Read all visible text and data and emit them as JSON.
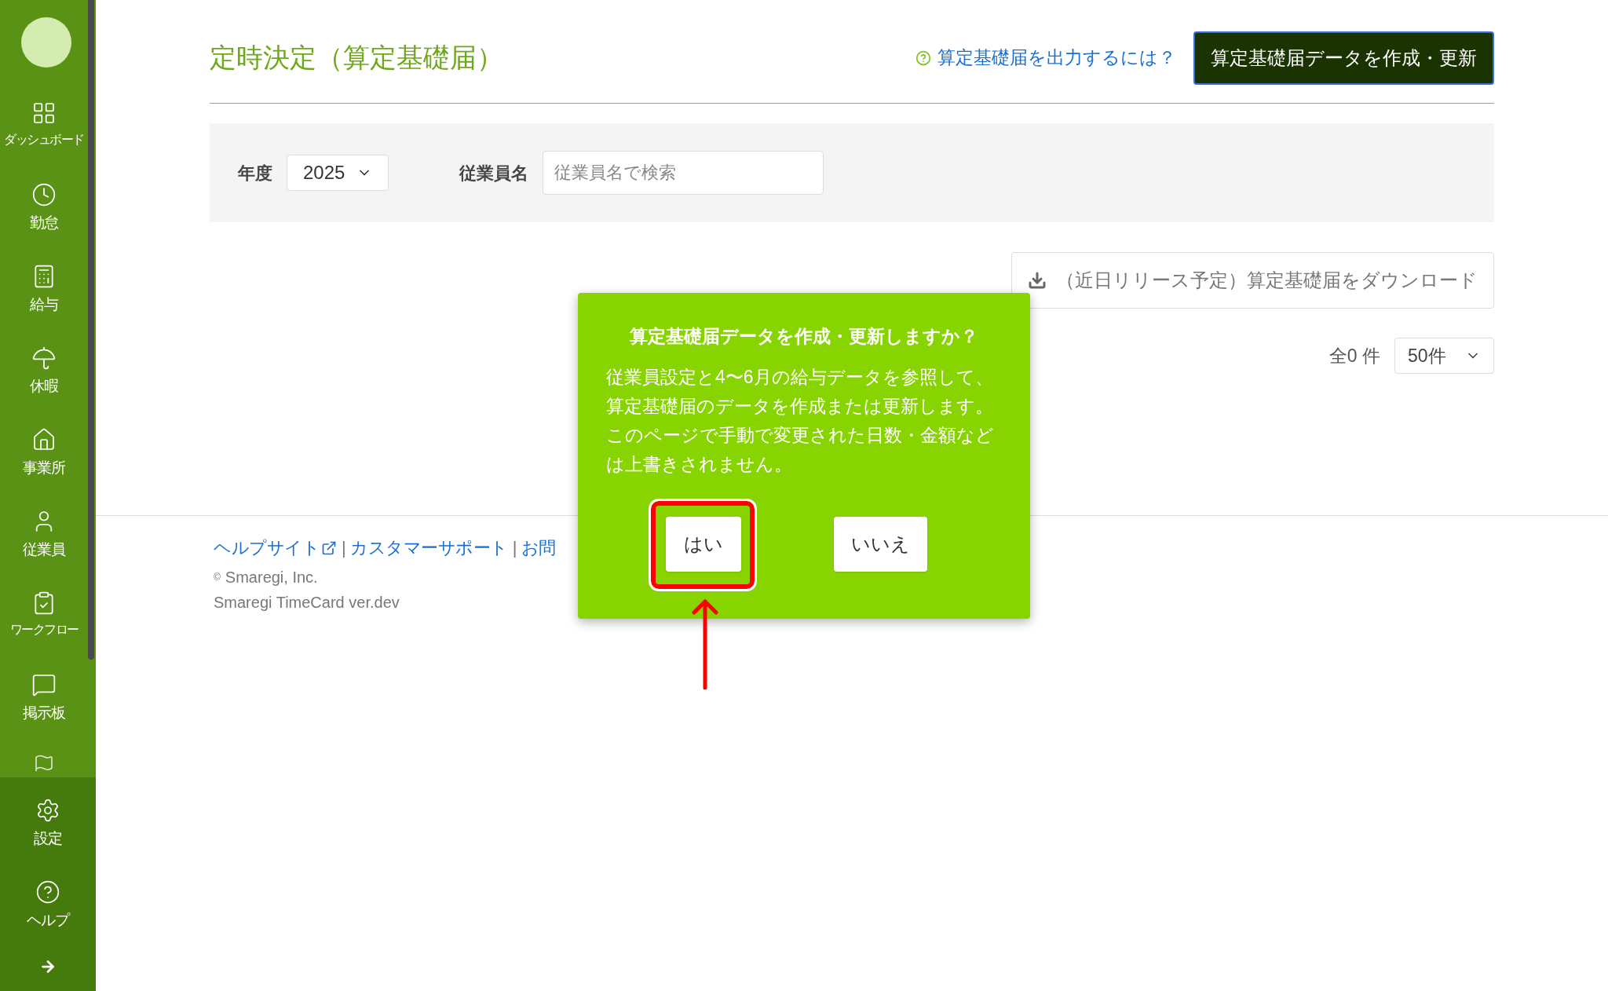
{
  "sidebar": {
    "items": [
      {
        "kind": "dashboard",
        "label": "ダッシュボード"
      },
      {
        "kind": "clock",
        "label": "勤怠"
      },
      {
        "kind": "calculator",
        "label": "給与"
      },
      {
        "kind": "umbrella",
        "label": "休暇"
      },
      {
        "kind": "home",
        "label": "事業所"
      },
      {
        "kind": "user",
        "label": "従業員"
      },
      {
        "kind": "clipboard",
        "label": "ワークフロー"
      },
      {
        "kind": "message",
        "label": "掲示板"
      },
      {
        "kind": "flag"
      }
    ],
    "bottom_items": [
      {
        "kind": "settings",
        "label": "設定"
      },
      {
        "kind": "help",
        "label": "ヘルプ"
      },
      {
        "kind": "arrow"
      }
    ]
  },
  "page": {
    "title": "定時決定（算定基礎届）",
    "help_link": "算定基礎届を出力するには？",
    "primary_button": "算定基礎届データを作成・更新"
  },
  "filters": {
    "year_label": "年度",
    "year_value": "2025",
    "employee_label": "従業員名",
    "employee_placeholder": "従業員名で検索"
  },
  "download_button": "（近日リリース予定）算定基礎届をダウンロード",
  "total_count": "全0 件",
  "page_size": "50件",
  "footer": {
    "links": [
      {
        "label": "ヘルプサイト",
        "external": true
      },
      {
        "label": "カスタマーサポート",
        "external": false
      },
      {
        "label": "お問",
        "external": false
      }
    ],
    "separator": "|",
    "copyright_mark": "©",
    "copyright": "Smaregi, Inc.",
    "version": "Smaregi TimeCard ver.dev"
  },
  "dialog": {
    "title": "算定基礎届データを作成・更新しますか？",
    "body": [
      "従業員設定と4〜6月の給与データを参照して、",
      "算定基礎届のデータを作成または更新します。",
      "このページで手動で変更された日数・金額など",
      "は上書きされません。"
    ],
    "buttons": [
      {
        "label": "はい",
        "highlighted": true
      },
      {
        "label": "いいえ",
        "highlighted": false
      }
    ]
  }
}
